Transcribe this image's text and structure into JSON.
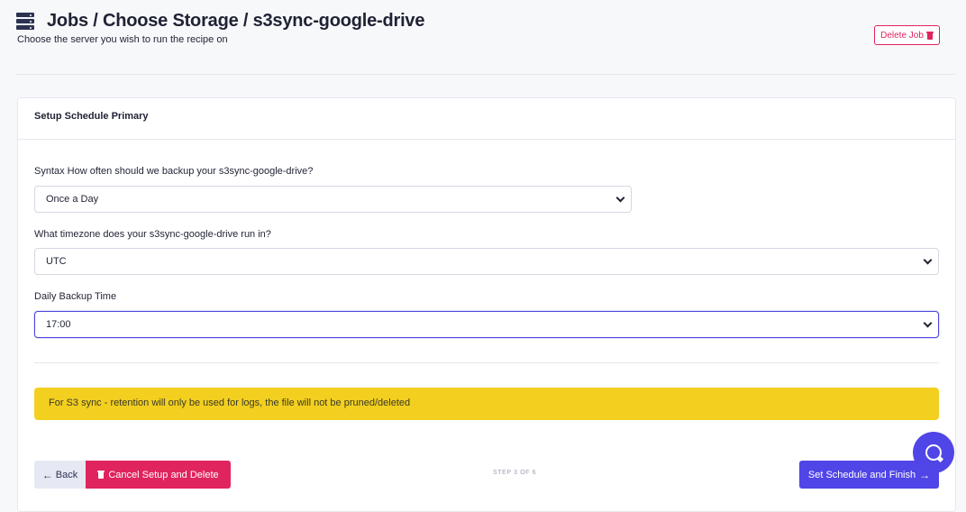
{
  "header": {
    "title": "Jobs / Choose Storage / s3sync-google-drive",
    "subtitle": "Choose the server you wish to run the recipe on",
    "delete_job_label": "Delete Job"
  },
  "card": {
    "title": "Setup Schedule Primary",
    "frequency": {
      "label": "Syntax How often should we backup your s3sync-google-drive?",
      "value": "Once a Day"
    },
    "timezone": {
      "label": "What timezone does your s3sync-google-drive run in?",
      "value": "UTC"
    },
    "backup_time": {
      "label": "Daily Backup Time",
      "value": "17:00"
    },
    "notice": "For S3 sync - retention will only be used for logs, the file will not be pruned/deleted"
  },
  "footer": {
    "back_label": "Back",
    "cancel_label": "Cancel Setup and Delete",
    "step_text": "STEP 3 OF 6",
    "finish_label": "Set Schedule and Finish"
  },
  "icons": {
    "header": "server-icon",
    "delete": "trash-icon",
    "back": "arrow-left-icon",
    "finish": "arrow-right-icon",
    "chat": "chat-icon"
  },
  "colors": {
    "accent": "#5045e6",
    "danger": "#e0245e",
    "notice": "#f3cf1f"
  }
}
